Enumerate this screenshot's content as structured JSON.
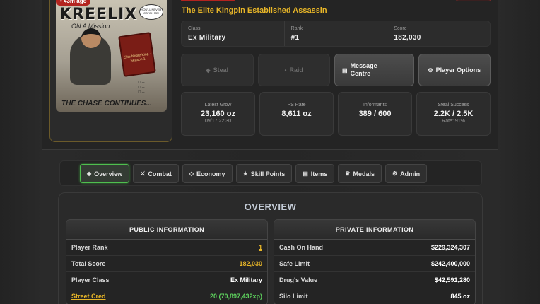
{
  "player": {
    "badge": "• 43m ago",
    "subtitle": "The Elite Kingpin Established Assassin"
  },
  "avatar": {
    "poster_title": "KREELIX",
    "poster_sub": "ON A Mission...",
    "poster_foot": "THE CHASE CONTINUES...",
    "book_text": "Elite Noble King · Season 1",
    "bubble_text": "YOU'LL NEVER CATCH ME!"
  },
  "info": [
    {
      "label": "Class",
      "value": "Ex Military"
    },
    {
      "label": "Rank",
      "value": "#1"
    },
    {
      "label": "Score",
      "value": "182,030"
    }
  ],
  "actions": [
    {
      "label": "Steal",
      "icon": "◆",
      "icon_name": "diamond-icon",
      "enabled": false
    },
    {
      "label": "Raid",
      "icon": "•",
      "icon_name": "dot-icon",
      "enabled": false
    },
    {
      "label": "Message Centre",
      "icon": "▤",
      "icon_name": "message-icon",
      "enabled": true
    },
    {
      "label": "Player Options",
      "icon": "⚙",
      "icon_name": "gear-icon",
      "enabled": true
    }
  ],
  "stats": [
    {
      "label": "Latest Grow",
      "value": "23,160 oz",
      "sub": "09/17 22:30"
    },
    {
      "label": "PS Rate",
      "value": "8,611 oz",
      "sub": ""
    },
    {
      "label": "Informants",
      "value": "389 / 600",
      "sub": ""
    },
    {
      "label": "Steal Success",
      "value": "2.2K / 2.5K",
      "sub": "Rate: 91%"
    }
  ],
  "tabs": [
    {
      "label": "Overview",
      "icon": "◆",
      "icon_name": "diamond-icon",
      "active": true
    },
    {
      "label": "Combat",
      "icon": "⚔",
      "icon_name": "swords-icon",
      "active": false
    },
    {
      "label": "Economy",
      "icon": "◇",
      "icon_name": "diamond-outline-icon",
      "active": false
    },
    {
      "label": "Skill Points",
      "icon": "★",
      "icon_name": "star-icon",
      "active": false
    },
    {
      "label": "Items",
      "icon": "▤",
      "icon_name": "box-icon",
      "active": false
    },
    {
      "label": "Medals",
      "icon": "♛",
      "icon_name": "medal-icon",
      "active": false
    },
    {
      "label": "Admin",
      "icon": "⚙",
      "icon_name": "gear-icon",
      "active": false
    }
  ],
  "overview": {
    "title": "OVERVIEW",
    "public": {
      "heading": "PUBLIC INFORMATION",
      "rows": [
        {
          "key": "Player Rank",
          "value": "1"
        },
        {
          "key": "Total Score",
          "value": "182,030"
        },
        {
          "key": "Player Class",
          "value": "Ex Military"
        },
        {
          "key": "Street Cred",
          "value": "20 (70,897,432xp)"
        }
      ]
    },
    "private": {
      "heading": "PRIVATE INFORMATION",
      "rows": [
        {
          "key": "Cash On Hand",
          "value": "$229,324,307"
        },
        {
          "key": "Safe Limit",
          "value": "$242,400,000"
        },
        {
          "key": "Drug's Value",
          "value": "$42,591,280"
        },
        {
          "key": "Silo Limit",
          "value": "845 oz"
        }
      ]
    }
  },
  "colors": {
    "accent_gold": "#e8b628",
    "accent_green": "#5ed35e",
    "alert_red": "#b3231f"
  }
}
